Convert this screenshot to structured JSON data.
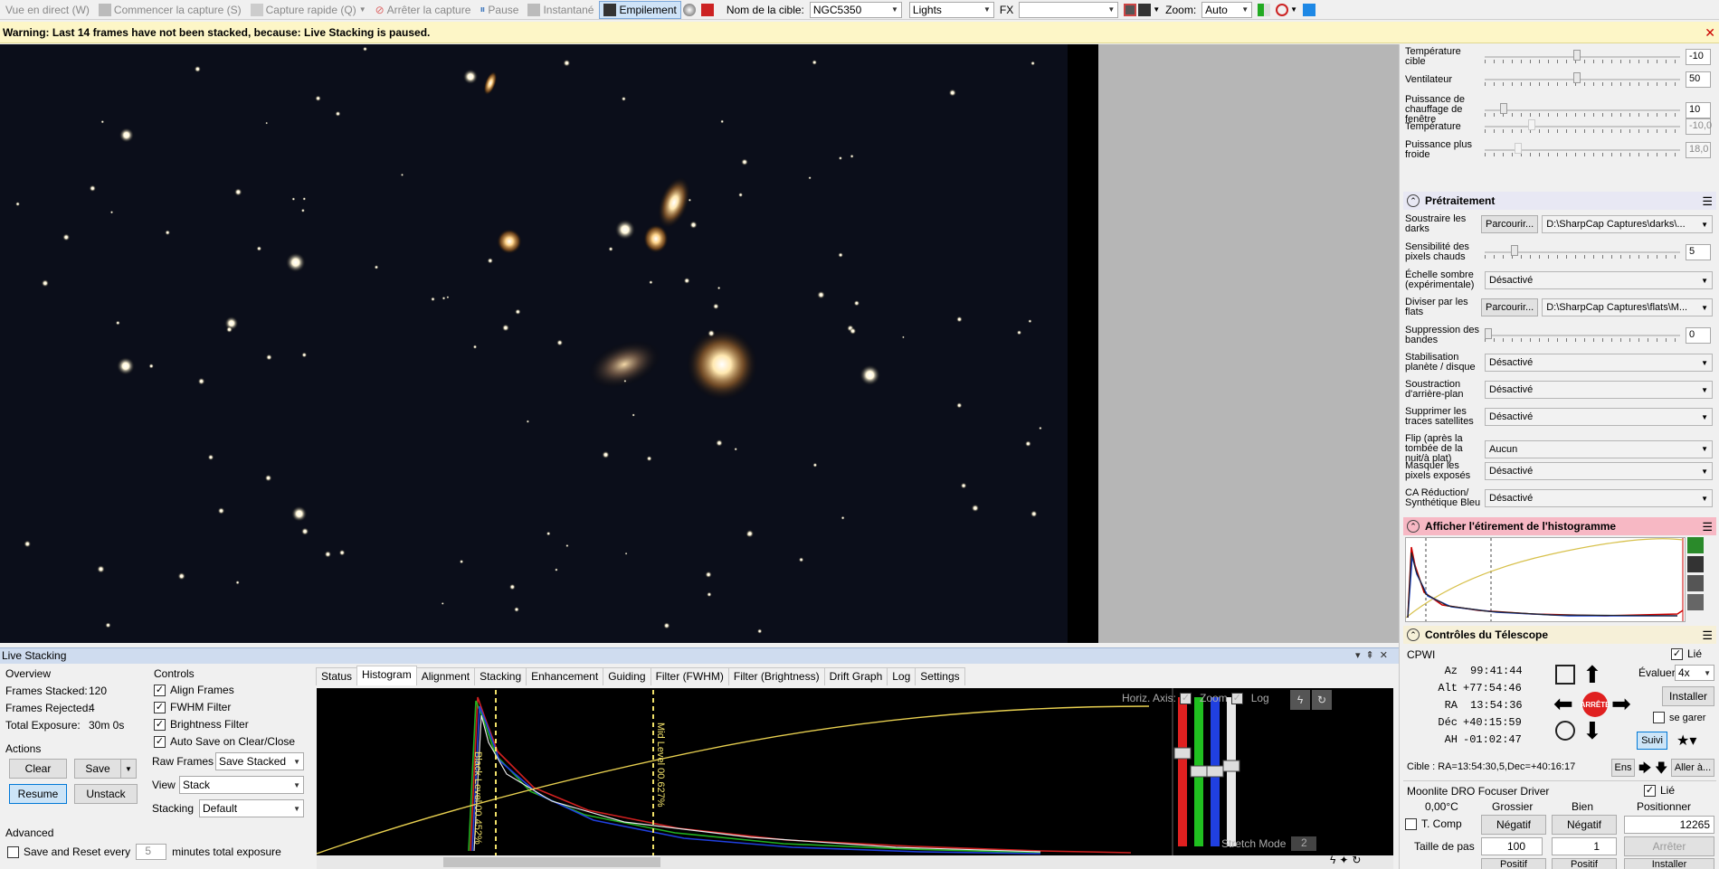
{
  "toolbar": {
    "live_view": "Vue en direct (W)",
    "start_capture": "Commencer la capture (S)",
    "quick_capture": "Capture rapide (Q)",
    "stop_capture": "Arrêter la capture",
    "pause": "Pause",
    "snapshot": "Instantané",
    "stacking": "Empilement",
    "target_label": "Nom de la cible:",
    "target_value": "NGC5350",
    "frame_type": "Lights",
    "fx_label": "FX",
    "fx_value": "",
    "zoom_label": "Zoom:",
    "zoom_value": "Auto"
  },
  "warning": {
    "text": "Warning: Last 14 frames have not been stacked, because: Live Stacking is paused."
  },
  "camera_controls": {
    "rows": [
      {
        "label": "Température cible",
        "value": "-10",
        "level": 0.47,
        "disabled": false
      },
      {
        "label": "Ventilateur",
        "value": "50",
        "level": 0.47,
        "disabled": false
      },
      {
        "label": "Puissance de chauffage de fenêtre",
        "value": "10",
        "level": 0.08,
        "disabled": false
      },
      {
        "label": "Température",
        "value": "-10,0",
        "level": 0.23,
        "disabled": true
      },
      {
        "label": "Puissance plus froide",
        "value": "18,0",
        "level": 0.16,
        "disabled": true
      }
    ]
  },
  "preprocessing": {
    "title": "Prétraitement",
    "darks_label": "Soustraire les darks",
    "browse": "Parcourir...",
    "darks_path": "D:\\SharpCap Captures\\darks\\...",
    "hot_pixels_label": "Sensibilité des pixels chauds",
    "hot_pixels_value": "5",
    "hot_pixels_level": 0.14,
    "dark_scale_label": "Échelle sombre (expérimentale)",
    "dark_scale_value": "Désactivé",
    "flats_label": "Diviser par les flats",
    "flats_path": "D:\\SharpCap Captures\\flats\\M...",
    "banding_label": "Suppression des bandes",
    "banding_value": "0",
    "banding_level": 0.0,
    "stab_label": "Stabilisation planète / disque",
    "stab_value": "Désactivé",
    "bg_label": "Soustraction d'arrière-plan",
    "bg_value": "Désactivé",
    "sat_label": "Supprimer les traces satellites",
    "sat_value": "Désactivé",
    "flip_label": "Flip (après la tombée de la nuit/à plat)",
    "flip_value": "Aucun",
    "mask_label": "Masquer les pixels exposés",
    "mask_value": "Désactivé",
    "ca_label": "CA Réduction/ Synthétique Bleu",
    "ca_value": "Désactivé"
  },
  "histogram_stretch": {
    "title": "Afficher l'étirement de l'histogramme"
  },
  "telescope": {
    "title": "Contrôles du Télescope",
    "mount": "CPWI",
    "linked": "Lié",
    "az_label": "Az",
    "az": "99:41:44",
    "alt_label": "Alt",
    "alt": "+77:54:46",
    "ra_label": "RA",
    "ra": "13:54:36",
    "dec_label": "Déc",
    "dec": "+40:15:59",
    "ha_label": "AH",
    "ha": "-01:02:47",
    "rate_label": "Évaluer:",
    "rate": "4x",
    "install": "Installer",
    "park": "se garer",
    "stop": "ARRÊTE",
    "track": "Suivi",
    "target": "Cible : RA=13:54:30,5,Dec=+40:16:17",
    "ens": "Ens",
    "goto": "Aller à..."
  },
  "focuser": {
    "title": "Moonlite DRO Focuser Driver",
    "linked": "Lié",
    "temp": "0,00°C",
    "coarse": "Grossier",
    "fine": "Bien",
    "positioner": "Positionner",
    "tcomp": "T. Comp",
    "negative": "Négatif",
    "position": "12265",
    "step_label": "Taille de pas",
    "step_coarse": "100",
    "step_fine": "1",
    "stop": "Arrêter",
    "positive": "Positif",
    "install": "Installer"
  },
  "live_stacking": {
    "title": "Live Stacking",
    "overview": "Overview",
    "frames_stacked_label": "Frames Stacked:",
    "frames_stacked": "120",
    "frames_rejected_label": "Frames Rejected:",
    "frames_rejected": "4",
    "total_exposure_label": "Total Exposure:",
    "total_exposure": "30m 0s",
    "actions": "Actions",
    "clear": "Clear",
    "save": "Save",
    "resume": "Resume",
    "unstack": "Unstack",
    "advanced": "Advanced",
    "save_reset": "Save and Reset every",
    "save_reset_value": "5",
    "save_reset_unit": "minutes total exposure",
    "controls": "Controls",
    "align": "Align Frames",
    "fwhm": "FWHM Filter",
    "brightness": "Brightness Filter",
    "autosave": "Auto Save on Clear/Close",
    "raw_frames_label": "Raw Frames",
    "raw_frames_value": "Save Stacked",
    "view_label": "View",
    "view_value": "Stack",
    "stacking_label": "Stacking",
    "stacking_value": "Default",
    "tabs": [
      "Status",
      "Histogram",
      "Alignment",
      "Stacking",
      "Enhancement",
      "Guiding",
      "Filter (FWHM)",
      "Filter (Brightness)",
      "Drift Graph",
      "Log",
      "Settings"
    ],
    "selected_tab": 1,
    "hist": {
      "horiz_axis": "Horiz. Axis:",
      "zoom": "Zoom",
      "log": "Log",
      "black_level": "Black Level 00.452%",
      "mid_level": "Mid Level 00.627%",
      "stretch_mode": "Stretch Mode",
      "stretch_value": "2"
    }
  }
}
